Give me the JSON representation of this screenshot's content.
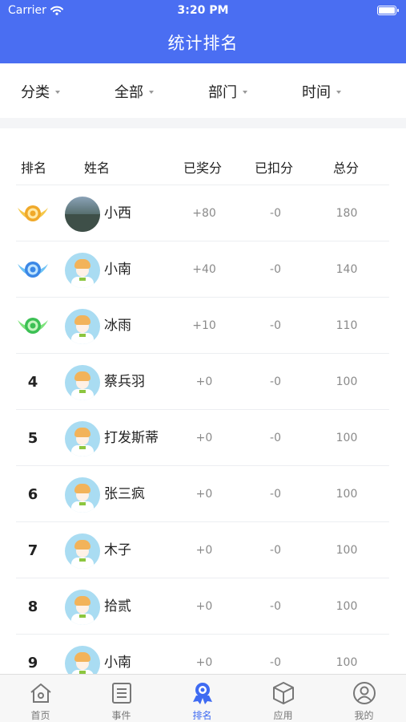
{
  "status_bar": {
    "carrier": "Carrier",
    "time": "3:20 PM"
  },
  "header": {
    "title": "统计排名"
  },
  "filters": [
    {
      "label": "分类"
    },
    {
      "label": "全部"
    },
    {
      "label": "部门"
    },
    {
      "label": "时间"
    }
  ],
  "table": {
    "columns": {
      "rank": "排名",
      "name": "姓名",
      "awarded": "已奖分",
      "deducted": "已扣分",
      "total": "总分"
    },
    "rows": [
      {
        "rank": "1",
        "medal": "gold",
        "avatar": "photo",
        "name": "小西",
        "awarded": "+80",
        "deducted": "-0",
        "total": "180"
      },
      {
        "rank": "2",
        "medal": "blue",
        "avatar": "default",
        "name": "小南",
        "awarded": "+40",
        "deducted": "-0",
        "total": "140"
      },
      {
        "rank": "3",
        "medal": "green",
        "avatar": "default",
        "name": "冰雨",
        "awarded": "+10",
        "deducted": "-0",
        "total": "110"
      },
      {
        "rank": "4",
        "avatar": "default",
        "name": "蔡兵羽",
        "awarded": "+0",
        "deducted": "-0",
        "total": "100"
      },
      {
        "rank": "5",
        "avatar": "default",
        "name": "打发斯蒂",
        "awarded": "+0",
        "deducted": "-0",
        "total": "100"
      },
      {
        "rank": "6",
        "avatar": "default",
        "name": "张三疯",
        "awarded": "+0",
        "deducted": "-0",
        "total": "100"
      },
      {
        "rank": "7",
        "avatar": "default",
        "name": "木子",
        "awarded": "+0",
        "deducted": "-0",
        "total": "100"
      },
      {
        "rank": "8",
        "avatar": "default",
        "name": "拾贰",
        "awarded": "+0",
        "deducted": "-0",
        "total": "100"
      },
      {
        "rank": "9",
        "avatar": "default",
        "name": "小南",
        "awarded": "+0",
        "deducted": "-0",
        "total": "100"
      }
    ]
  },
  "tabbar": {
    "active": "ranking",
    "items": [
      {
        "key": "home",
        "label": "首页",
        "icon": "home-icon"
      },
      {
        "key": "events",
        "label": "事件",
        "icon": "list-icon"
      },
      {
        "key": "ranking",
        "label": "排名",
        "icon": "ranking-icon"
      },
      {
        "key": "apps",
        "label": "应用",
        "icon": "cube-icon"
      },
      {
        "key": "mine",
        "label": "我的",
        "icon": "user-icon"
      }
    ]
  },
  "colors": {
    "primary": "#4a6ef2",
    "tab_active": "#3f6bf2",
    "muted_text": "#8a8a8a"
  }
}
